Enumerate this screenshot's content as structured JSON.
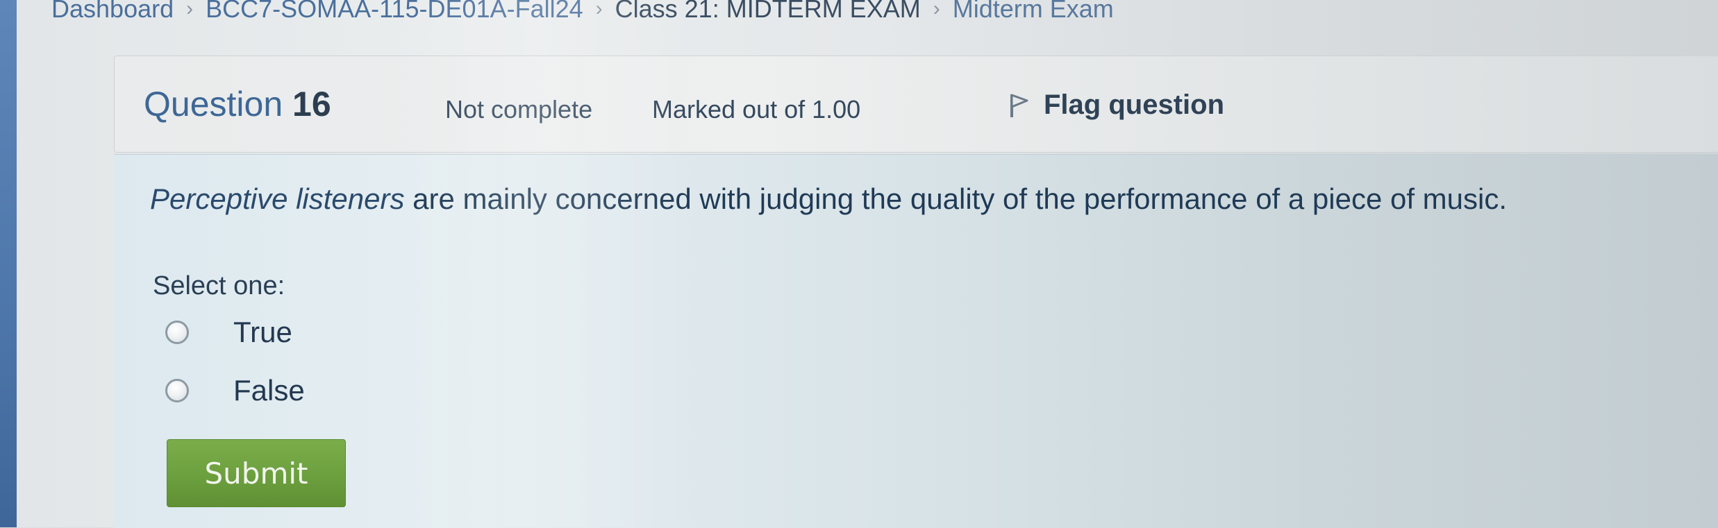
{
  "breadcrumb": {
    "items": [
      {
        "label": "Dashboard"
      },
      {
        "label": "BCC7-SOMAA-115-DE01A-Fall24"
      },
      {
        "label": "Class 21: MIDTERM EXAM"
      },
      {
        "label": "Midterm Exam"
      }
    ],
    "separator": "›"
  },
  "question_info": {
    "title_prefix": "Question",
    "number": "16",
    "state": "Not complete",
    "grade": "Marked out of 1.00",
    "flag_label": "Flag question"
  },
  "question": {
    "text_emphasis": "Perceptive listeners",
    "text_rest": " are mainly concerned with judging the quality of the performance of a piece of music.",
    "prompt": "Select one:",
    "options": [
      {
        "label": "True",
        "selected": false
      },
      {
        "label": "False",
        "selected": false
      }
    ]
  },
  "actions": {
    "submit_label": "Submit"
  },
  "colors": {
    "link": "#4a6f9c",
    "submit_button": "#6c9f3e",
    "content_background": "#dde9ef",
    "info_background": "#eeefef"
  },
  "icons": {
    "flag": "flag-icon",
    "breadcrumb_separator": "chevron-right-icon"
  }
}
